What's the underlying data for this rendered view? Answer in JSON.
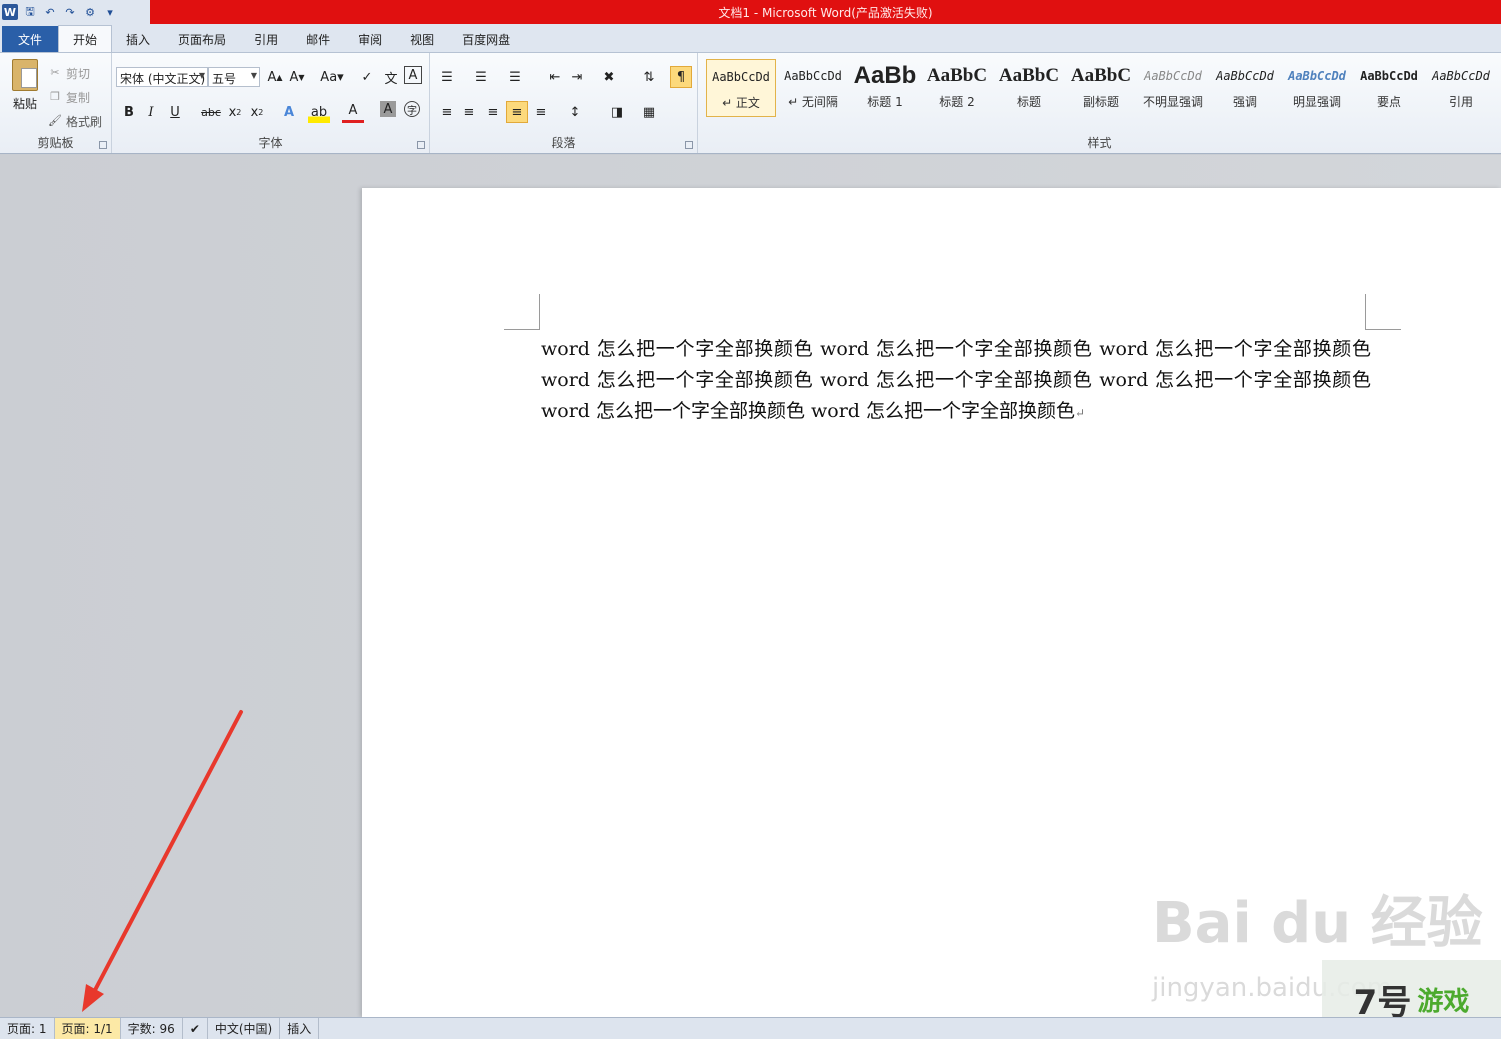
{
  "title": "文档1 - Microsoft Word(产品激活失败)",
  "tabs": [
    "文件",
    "开始",
    "插入",
    "页面布局",
    "引用",
    "邮件",
    "审阅",
    "视图",
    "百度网盘"
  ],
  "clipboard": {
    "paste": "粘贴",
    "cut": "剪切",
    "copy": "复制",
    "format_painter": "格式刷",
    "label": "剪贴板"
  },
  "font": {
    "name": "宋体 (中文正文)",
    "size": "五号",
    "label": "字体"
  },
  "paragraph": {
    "label": "段落"
  },
  "styles": {
    "label": "样式",
    "items": [
      {
        "sample": "AaBbCcDd",
        "name": "↵ 正文"
      },
      {
        "sample": "AaBbCcDd",
        "name": "↵ 无间隔"
      },
      {
        "sample": "AaBb",
        "name": "标题 1"
      },
      {
        "sample": "AaBbC",
        "name": "标题 2"
      },
      {
        "sample": "AaBbC",
        "name": "标题"
      },
      {
        "sample": "AaBbC",
        "name": "副标题"
      },
      {
        "sample": "AaBbCcDd",
        "name": "不明显强调"
      },
      {
        "sample": "AaBbCcDd",
        "name": "强调"
      },
      {
        "sample": "AaBbCcDd",
        "name": "明显强调"
      },
      {
        "sample": "AaBbCcDd",
        "name": "要点"
      },
      {
        "sample": "AaBbCcDd",
        "name": "引用"
      }
    ]
  },
  "document": {
    "text": "word 怎么把一个字全部换颜色 word 怎么把一个字全部换颜色 word 怎么把一个字全部换颜色 word 怎么把一个字全部换颜色 word 怎么把一个字全部换颜色 word 怎么把一个字全部换颜色 word 怎么把一个字全部换颜色 word 怎么把一个字全部换颜色",
    "paragraph_mark": "↵"
  },
  "watermark": {
    "line1": "Bai du 经验",
    "line2": "jingyan.baidu.com",
    "logo_num": "7号",
    "logo_text": "游戏"
  },
  "statusbar": {
    "page": "页面: 1",
    "pages": "页面: 1/1",
    "words": "字数: 96",
    "language": "中文(中国)",
    "mode": "插入"
  },
  "colors": {
    "title_bar": "#e01010",
    "file_tab": "#2a5fa8",
    "arrow": "#e8382c"
  }
}
